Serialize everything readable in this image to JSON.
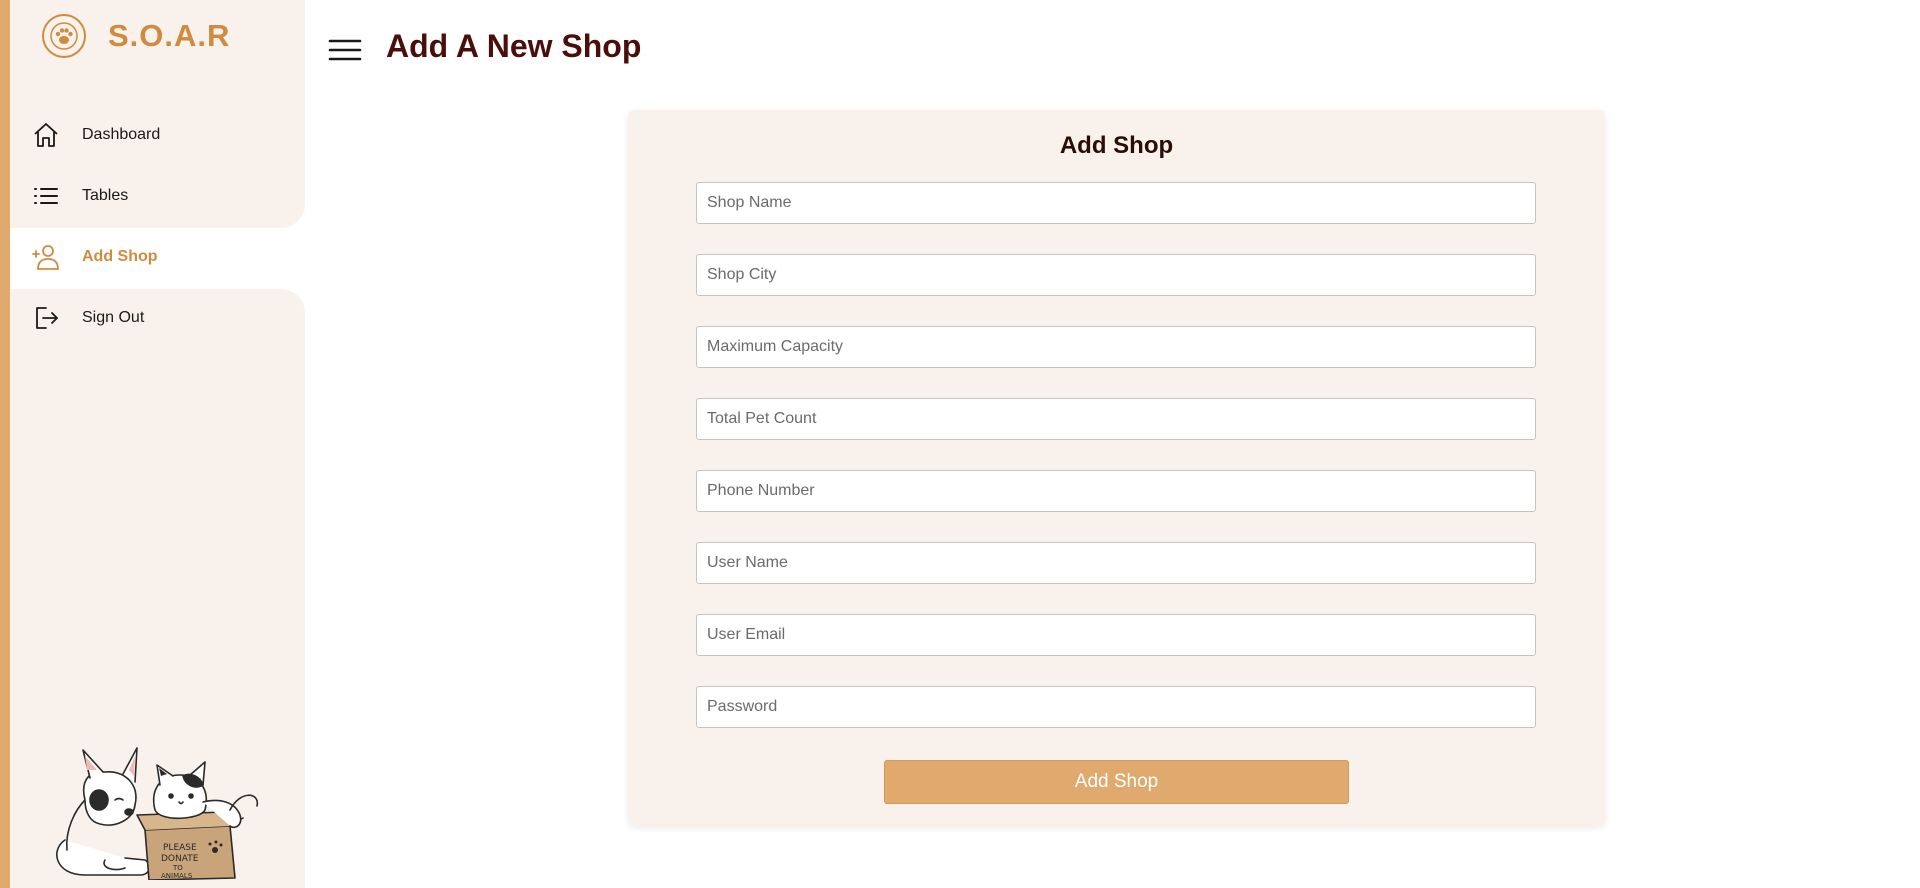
{
  "brand": {
    "name": "S.O.A.R"
  },
  "sidebar": {
    "items": [
      {
        "label": "Dashboard",
        "icon": "home-icon"
      },
      {
        "label": "Tables",
        "icon": "list-icon"
      },
      {
        "label": "Add Shop",
        "icon": "add-user-icon",
        "active": true
      },
      {
        "label": "Sign Out",
        "icon": "sign-out-icon"
      }
    ],
    "illustration_text": "PLEASE DONATE TO ANIMALS"
  },
  "header": {
    "title": "Add A New Shop"
  },
  "form": {
    "title": "Add Shop",
    "fields": [
      {
        "placeholder": "Shop Name",
        "value": ""
      },
      {
        "placeholder": "Shop City",
        "value": ""
      },
      {
        "placeholder": "Maximum Capacity",
        "value": ""
      },
      {
        "placeholder": "Total Pet Count",
        "value": ""
      },
      {
        "placeholder": "Phone Number",
        "value": ""
      },
      {
        "placeholder": "User Name",
        "value": ""
      },
      {
        "placeholder": "User Email",
        "value": ""
      },
      {
        "placeholder": "Password",
        "value": ""
      }
    ],
    "submit_label": "Add Shop"
  },
  "colors": {
    "accent": "#e0a96d",
    "brand": "#d08b3e",
    "sidebar_bg": "#f9f1eb",
    "title": "#4a0f0a"
  }
}
